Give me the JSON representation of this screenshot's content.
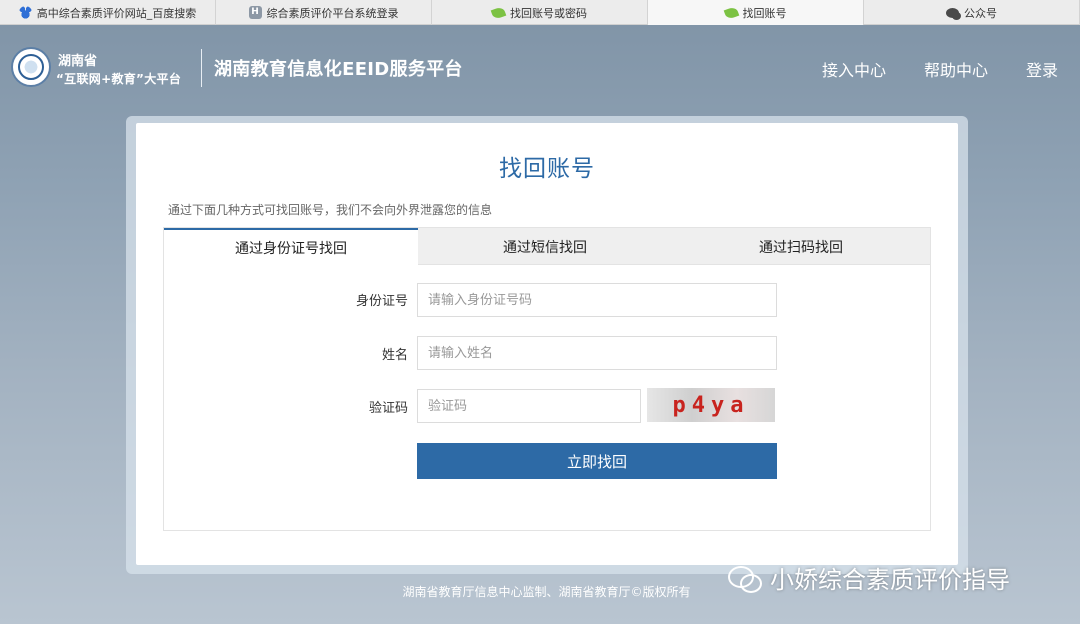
{
  "browser_tabs": [
    {
      "label": "高中综合素质评价网站_百度搜索",
      "icon": "baidu-paw-icon"
    },
    {
      "label": "综合素质评价平台系统登录",
      "icon": "h-letter-icon"
    },
    {
      "label": "找回账号或密码",
      "icon": "leaf-icon"
    },
    {
      "label": "找回账号",
      "icon": "leaf-icon"
    },
    {
      "label": "公众号",
      "icon": "wechat-icon"
    }
  ],
  "header": {
    "brand_line1": "湖南省",
    "brand_line2": "“互联网+教育”大平台",
    "title": "湖南教育信息化EEID服务平台",
    "nav": [
      "接入中心",
      "帮助中心",
      "登录"
    ]
  },
  "card": {
    "title": "找回账号",
    "description": "通过下面几种方式可找回账号，我们不会向外界泄露您的信息",
    "tabs": [
      "通过身份证号找回",
      "通过短信找回",
      "通过扫码找回"
    ],
    "active_tab": 0,
    "form": {
      "id_label": "身份证号",
      "id_placeholder": "请输入身份证号码",
      "name_label": "姓名",
      "name_placeholder": "请输入姓名",
      "code_label": "验证码",
      "code_placeholder": "验证码",
      "captcha_text": "p4ya",
      "submit_label": "立即找回"
    }
  },
  "footer": "湖南省教育厅信息中心监制、湖南省教育厅©版权所有",
  "watermark": "小娇综合素质评价指导",
  "colors": {
    "accent": "#2d6aa6",
    "captcha_text": "#c8231e"
  }
}
